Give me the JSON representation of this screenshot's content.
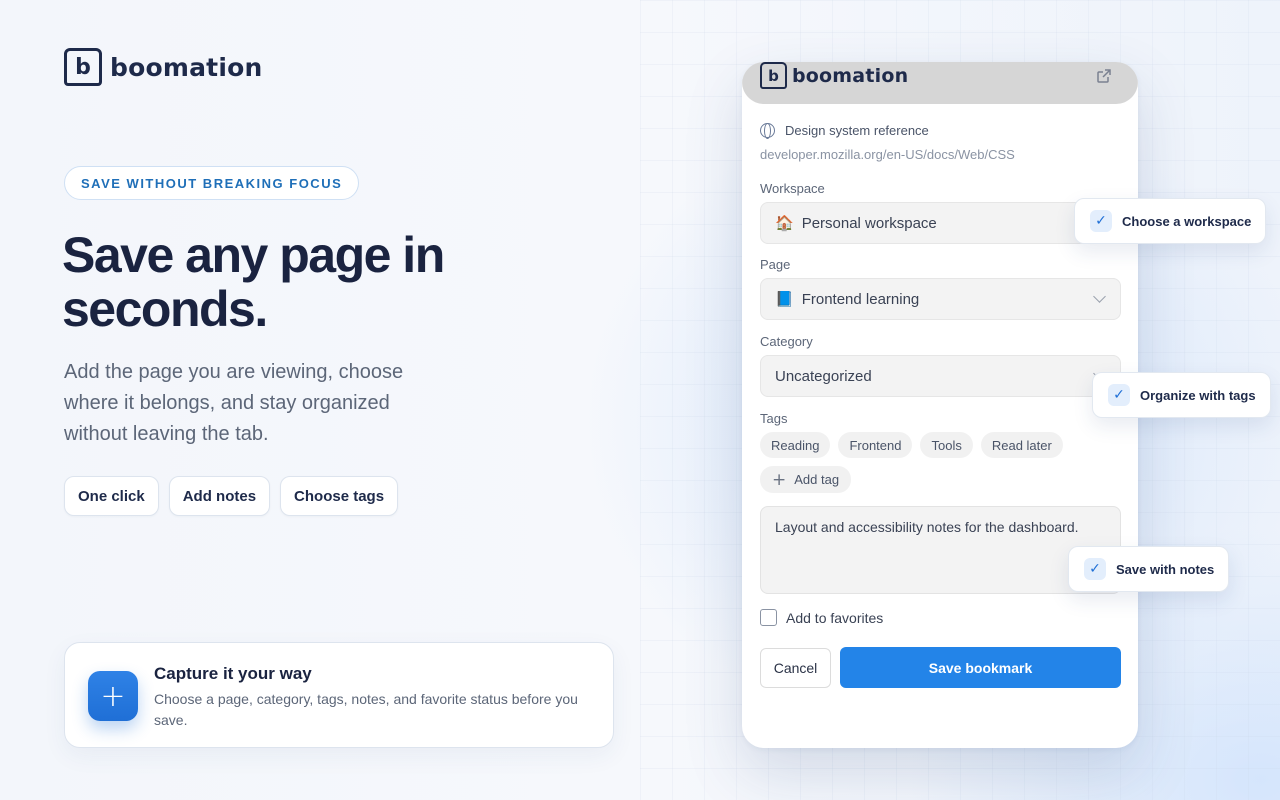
{
  "brand": {
    "mark_letter": "b",
    "name": "boomation"
  },
  "hero": {
    "eyebrow": "SAVE WITHOUT BREAKING FOCUS",
    "headline": "Save any page in seconds.",
    "lede": "Add the page you are viewing, choose where it belongs, and stay organized without leaving the tab.",
    "chips": [
      "One click",
      "Add notes",
      "Choose tags"
    ]
  },
  "capture_card": {
    "plus_glyph": "+",
    "title": "Capture it your way",
    "description": "Choose a page, category, tags, notes, and favorite status before you save."
  },
  "popup": {
    "brand_name": "boomation",
    "site": {
      "title": "Design system reference",
      "url": "developer.mozilla.org/en-US/docs/Web/CSS"
    },
    "workspace": {
      "label": "Workspace",
      "emoji": "🏠",
      "value": "Personal workspace"
    },
    "page": {
      "label": "Page",
      "emoji": "📘",
      "value": "Frontend learning"
    },
    "category": {
      "label": "Category",
      "value": "Uncategorized"
    },
    "tags": {
      "label": "Tags",
      "items": [
        "Reading",
        "Frontend",
        "Tools",
        "Read later"
      ],
      "add_label": "Add tag"
    },
    "notes": "Layout and accessibility notes for the dashboard.",
    "favorites_label": "Add to favorites",
    "favorite_checked": false,
    "cancel_label": "Cancel",
    "save_label": "Save bookmark"
  },
  "callouts": [
    {
      "label": "Choose a workspace"
    },
    {
      "label": "Organize with tags"
    },
    {
      "label": "Save with notes"
    }
  ],
  "colors": {
    "accent": "#2384e8",
    "heading": "#1a2340",
    "eyebrow": "#1f6fb8"
  }
}
